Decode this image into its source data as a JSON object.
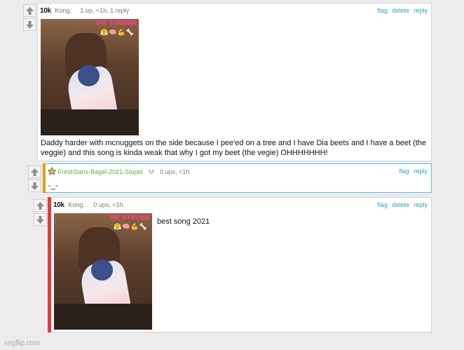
{
  "comments": [
    {
      "user_tag": "10k",
      "user_name": "Kong.",
      "meta": "1 up, <1h, 1 reply",
      "actions": [
        "flag",
        "delete",
        "reply"
      ],
      "image": {
        "banner": "ME STRONK",
        "emoji": "😤🧠💪🦴"
      },
      "text": "Daddy harder with mcnuggets on the side because I pee'ed on a tree and I have Dia beets and I have a beet (the veggie) and this song is kinda weak that why I got my beet (the vegie) OHHHHHHH!"
    },
    {
      "user_name": "FreshSans-Bagel-2021-Stupid",
      "mod_badge": "M",
      "meta": "0 ups, <1h",
      "actions": [
        "flag",
        "reply"
      ],
      "text": "-_-"
    },
    {
      "user_tag": "10k",
      "user_name": "Kong.",
      "meta": "0 ups, <1h",
      "actions": [
        "flag",
        "delete",
        "reply"
      ],
      "image": {
        "banner": "ME STRONK",
        "emoji": "😤🧠💪🦴"
      },
      "text": "best song 2021"
    }
  ],
  "watermark": "imgflip.com",
  "icons": {
    "upvote": "upvote-arrow-icon",
    "downvote": "downvote-arrow-icon",
    "star": "star-icon"
  },
  "colors": {
    "link": "#2aa3cd",
    "reply_border": "#55c2dc",
    "reply_bar": "#d9a020",
    "nested_bar": "#e8393a",
    "green_user": "#48b848",
    "star": "#f2c81e"
  }
}
